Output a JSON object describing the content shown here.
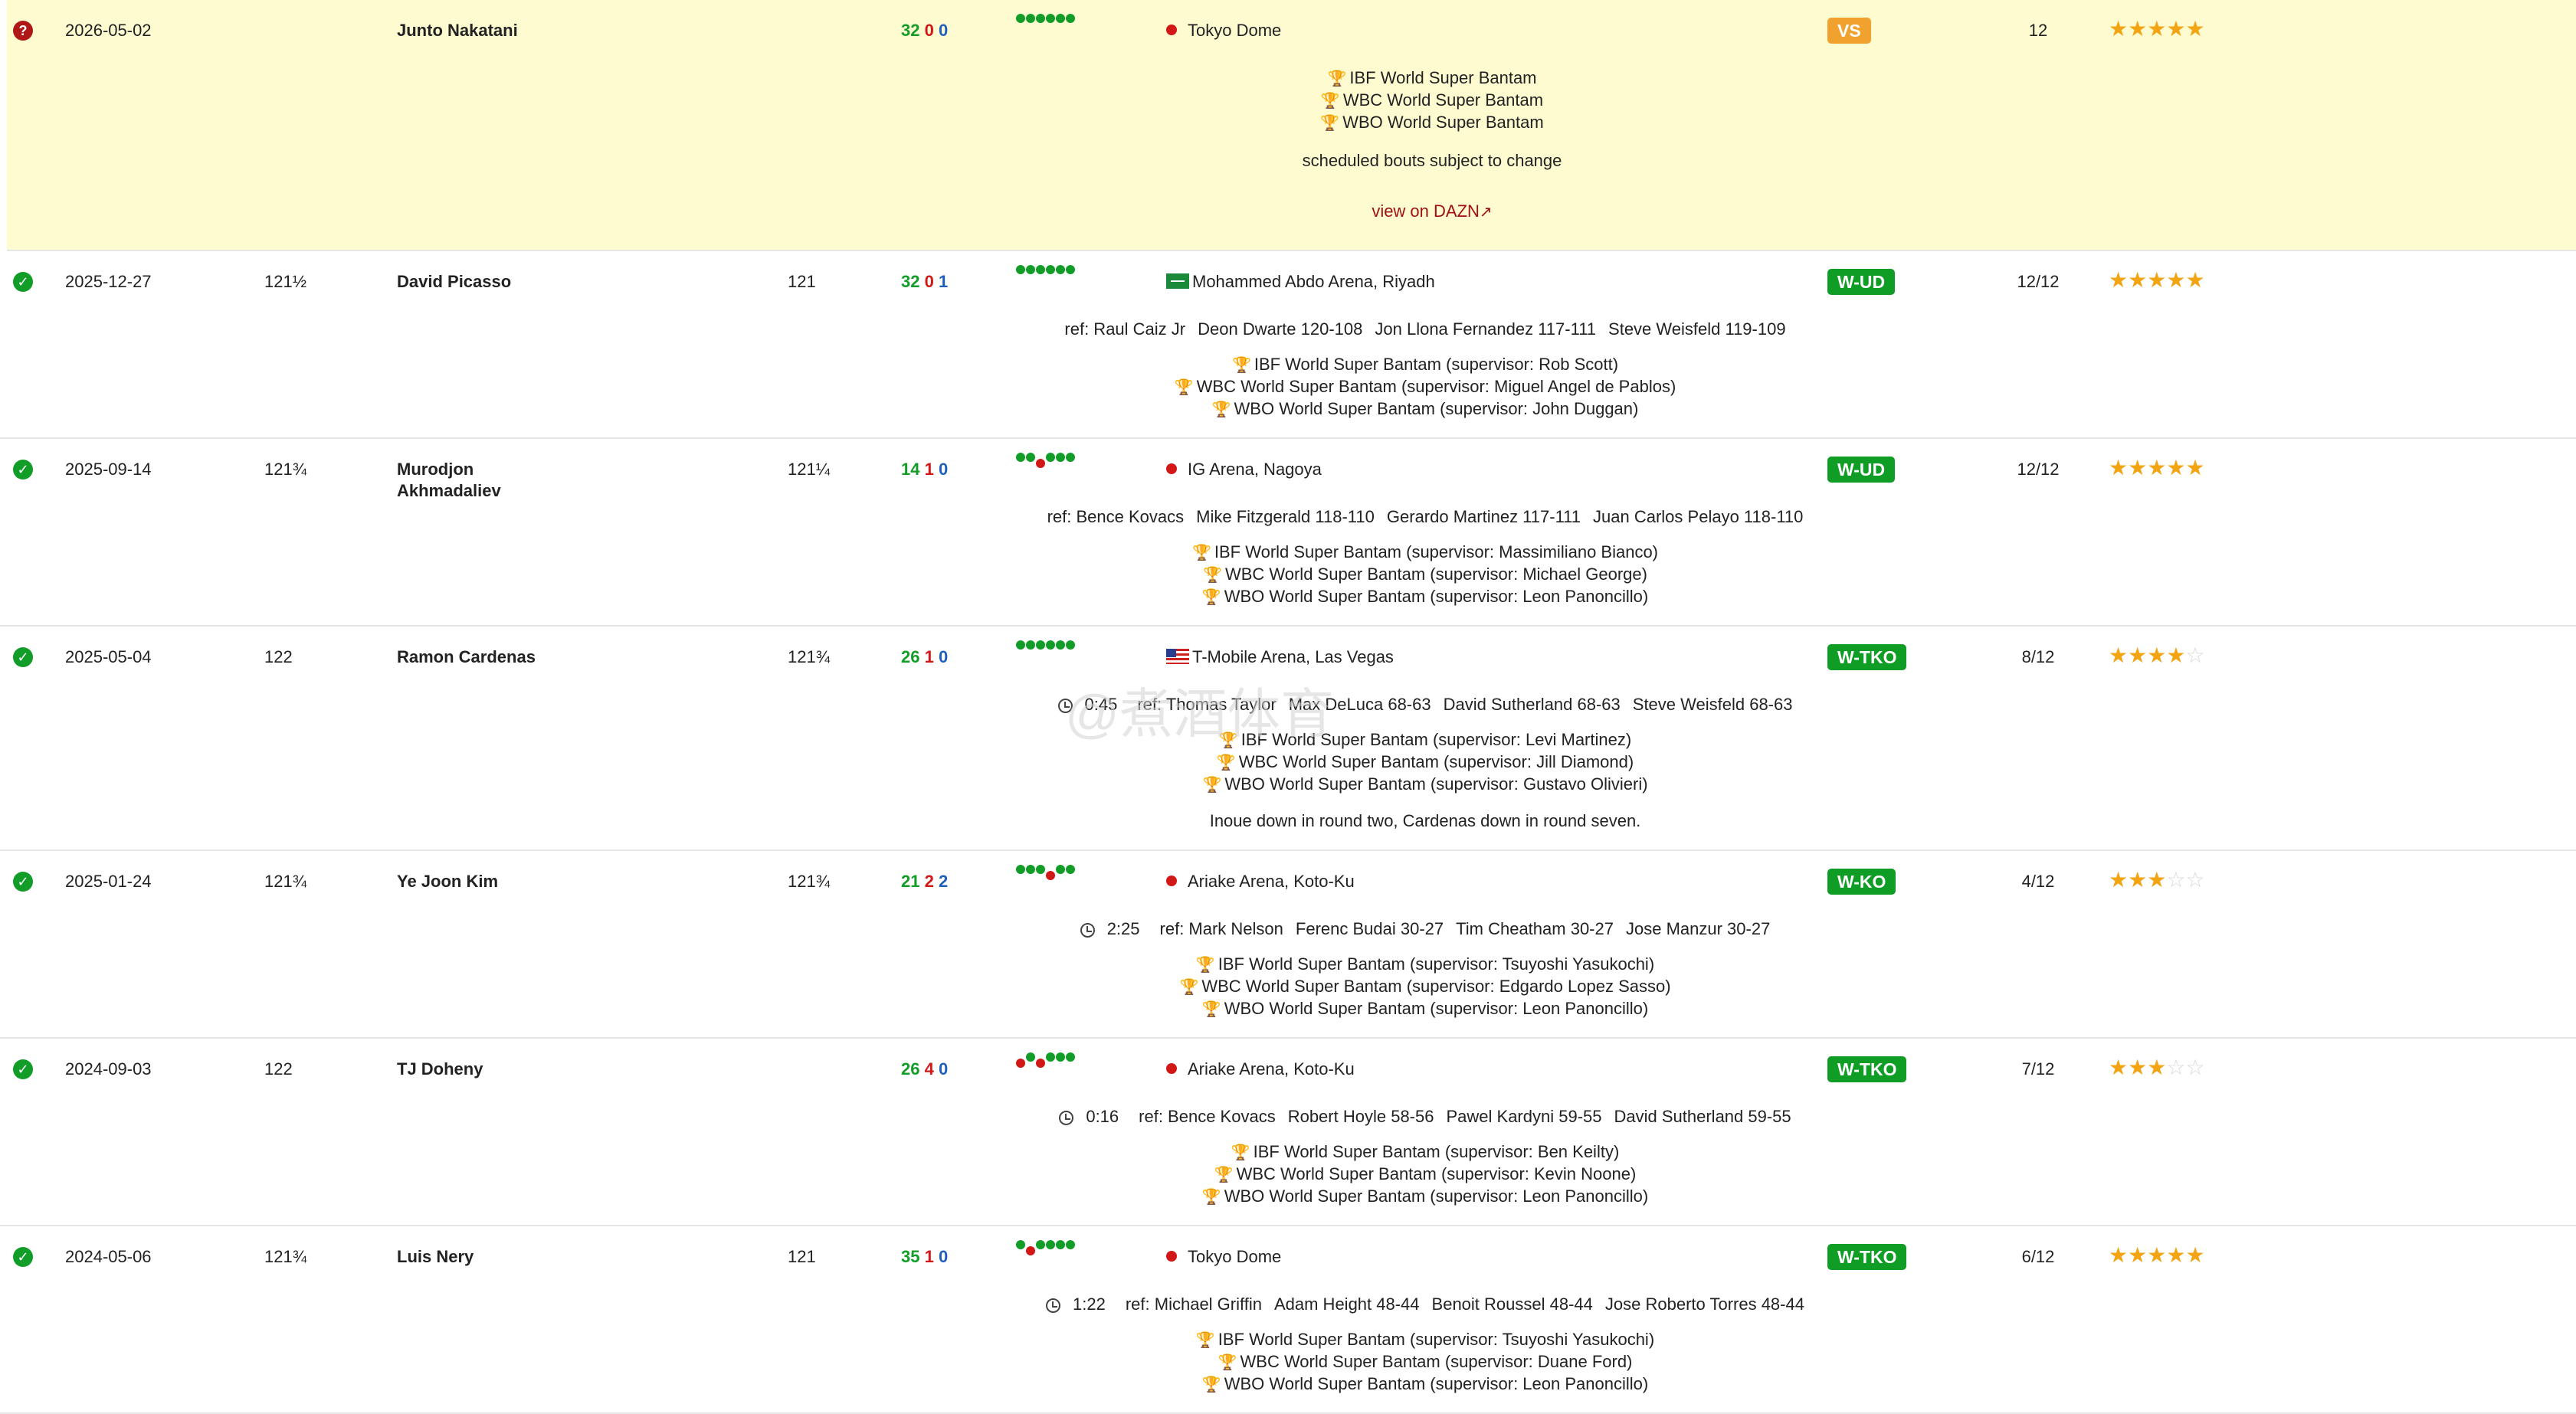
{
  "bouts": [
    {
      "status": "scheduled",
      "status_glyph": "?",
      "date": "2026-05-02",
      "weight": "",
      "opponent": "Junto Nakatani",
      "opp_weight": "",
      "record": {
        "w": "32",
        "l": "0",
        "d": "0"
      },
      "form": [
        "w",
        "w",
        "w",
        "w",
        "w",
        "w"
      ],
      "venue": "Tokyo Dome",
      "venue_icon": "japan-flag-icon",
      "result": "VS",
      "rounds": "12",
      "stars": 5,
      "officials": [],
      "time": "",
      "titles": [
        "IBF World Super Bantam",
        "WBC World Super Bantam",
        "WBO World Super Bantam"
      ],
      "note": "scheduled bouts subject to change",
      "link": "view on DAZN"
    },
    {
      "status": "win",
      "date": "2025-12-27",
      "weight": "121½",
      "opponent": "David Picasso",
      "opp_weight": "121",
      "record": {
        "w": "32",
        "l": "0",
        "d": "1"
      },
      "form": [
        "w",
        "w",
        "w",
        "w",
        "w",
        "w"
      ],
      "venue": "Mohammed Abdo Arena, Riyadh",
      "venue_icon": "saudi-flag-icon",
      "result": "W-UD",
      "rounds": "12/12",
      "stars": 5,
      "time": "",
      "officials": [
        "ref: Raul Caiz Jr",
        "Deon Dwarte 120-108",
        "Jon Llona Fernandez 117-111",
        "Steve Weisfeld 119-109"
      ],
      "titles": [
        "IBF World Super Bantam (supervisor: Rob Scott)",
        "WBC World Super Bantam (supervisor: Miguel Angel de Pablos)",
        "WBO World Super Bantam (supervisor: John Duggan)"
      ],
      "note": ""
    },
    {
      "status": "win",
      "date": "2025-09-14",
      "weight": "121¾",
      "opponent": "Murodjon Akhmadaliev",
      "opp_weight": "121¼",
      "record": {
        "w": "14",
        "l": "1",
        "d": "0"
      },
      "form": [
        "w",
        "w",
        "l",
        "w",
        "w",
        "w"
      ],
      "venue": "IG Arena, Nagoya",
      "venue_icon": "japan-flag-icon",
      "result": "W-UD",
      "rounds": "12/12",
      "stars": 5,
      "time": "",
      "officials": [
        "ref: Bence Kovacs",
        "Mike Fitzgerald 118-110",
        "Gerardo Martinez 117-111",
        "Juan Carlos Pelayo 118-110"
      ],
      "titles": [
        "IBF World Super Bantam (supervisor: Massimiliano Bianco)",
        "WBC World Super Bantam (supervisor: Michael George)",
        "WBO World Super Bantam (supervisor: Leon Panoncillo)"
      ],
      "note": ""
    },
    {
      "status": "win",
      "date": "2025-05-04",
      "weight": "122",
      "opponent": "Ramon Cardenas",
      "opp_weight": "121¾",
      "record": {
        "w": "26",
        "l": "1",
        "d": "0"
      },
      "form": [
        "w",
        "w",
        "w",
        "w",
        "w",
        "w"
      ],
      "venue": "T-Mobile Arena, Las Vegas",
      "venue_icon": "usa-flag-icon",
      "result": "W-TKO",
      "rounds": "8/12",
      "stars": 4,
      "time": "0:45",
      "officials": [
        "ref: Thomas Taylor",
        "Max DeLuca 68-63",
        "David Sutherland 68-63",
        "Steve Weisfeld 68-63"
      ],
      "titles": [
        "IBF World Super Bantam (supervisor: Levi Martinez)",
        "WBC World Super Bantam (supervisor: Jill Diamond)",
        "WBO World Super Bantam (supervisor: Gustavo Olivieri)"
      ],
      "note": "Inoue down in round two, Cardenas down in round seven."
    },
    {
      "status": "win",
      "date": "2025-01-24",
      "weight": "121¾",
      "opponent": "Ye Joon Kim",
      "opp_weight": "121¾",
      "record": {
        "w": "21",
        "l": "2",
        "d": "2"
      },
      "form": [
        "w",
        "w",
        "w",
        "l",
        "w",
        "w"
      ],
      "venue": "Ariake Arena, Koto-Ku",
      "venue_icon": "japan-flag-icon",
      "result": "W-KO",
      "rounds": "4/12",
      "stars": 3,
      "time": "2:25",
      "officials": [
        "ref: Mark Nelson",
        "Ferenc Budai 30-27",
        "Tim Cheatham 30-27",
        "Jose Manzur 30-27"
      ],
      "titles": [
        "IBF World Super Bantam (supervisor: Tsuyoshi Yasukochi)",
        "WBC World Super Bantam (supervisor: Edgardo Lopez Sasso)",
        "WBO World Super Bantam (supervisor: Leon Panoncillo)"
      ],
      "note": ""
    },
    {
      "status": "win",
      "date": "2024-09-03",
      "weight": "122",
      "opponent": "TJ Doheny",
      "opp_weight": "",
      "record": {
        "w": "26",
        "l": "4",
        "d": "0"
      },
      "form": [
        "l",
        "w",
        "l",
        "w",
        "w",
        "w"
      ],
      "venue": "Ariake Arena, Koto-Ku",
      "venue_icon": "japan-flag-icon",
      "result": "W-TKO",
      "rounds": "7/12",
      "stars": 3,
      "time": "0:16",
      "officials": [
        "ref: Bence Kovacs",
        "Robert Hoyle 58-56",
        "Pawel Kardyni 59-55",
        "David Sutherland 59-55"
      ],
      "titles": [
        "IBF World Super Bantam (supervisor: Ben Keilty)",
        "WBC World Super Bantam (supervisor: Kevin Noone)",
        "WBO World Super Bantam (supervisor: Leon Panoncillo)"
      ],
      "note": ""
    },
    {
      "status": "win",
      "date": "2024-05-06",
      "weight": "121¾",
      "opponent": "Luis Nery",
      "opp_weight": "121",
      "record": {
        "w": "35",
        "l": "1",
        "d": "0"
      },
      "form": [
        "w",
        "l",
        "w",
        "w",
        "w",
        "w"
      ],
      "venue": "Tokyo Dome",
      "venue_icon": "japan-flag-icon",
      "result": "W-TKO",
      "rounds": "6/12",
      "stars": 5,
      "time": "1:22",
      "officials": [
        "ref: Michael Griffin",
        "Adam Height 48-44",
        "Benoit Roussel 48-44",
        "Jose Roberto Torres 48-44"
      ],
      "titles": [
        "IBF World Super Bantam (supervisor: Tsuyoshi Yasukochi)",
        "WBC World Super Bantam (supervisor: Duane Ford)",
        "WBO World Super Bantam (supervisor: Leon Panoncillo)"
      ],
      "note": ""
    }
  ],
  "watermark": "@煮酒体育",
  "colors": {
    "win": "#119d27",
    "loss": "#d21717",
    "draw": "#1f5fbf",
    "result_badge": "#109d26",
    "vs_badge": "#f0a12e",
    "star": "#f3a412",
    "highlight_row": "#fffbd1"
  }
}
